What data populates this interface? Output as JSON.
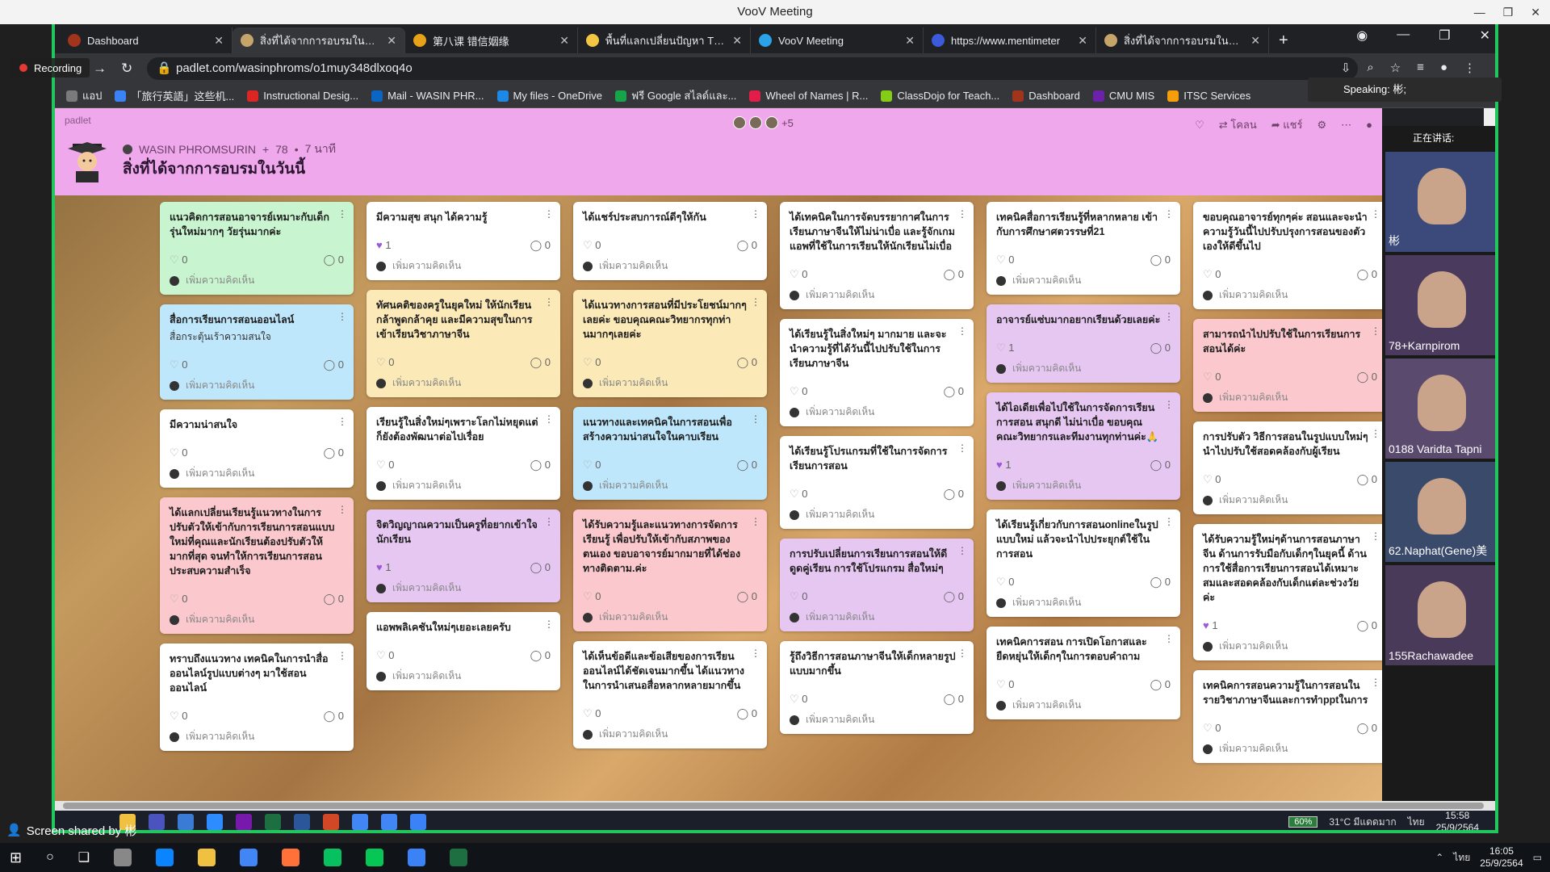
{
  "voov": {
    "title": "VooV Meeting",
    "recording_label": "Recording",
    "speaking_label": "Speaking: 彬;",
    "screen_shared_label": "Screen shared by 彬"
  },
  "browser": {
    "tabs": [
      {
        "label": "Dashboard",
        "active": false,
        "color": "#a0341c"
      },
      {
        "label": "สิ่งที่ได้จากการอบรมในวันนี้",
        "active": true,
        "color": "#c5a56a"
      },
      {
        "label": "第八课 错信姻缘",
        "active": false,
        "color": "#e8a21a"
      },
      {
        "label": "พื้นที่แลกเปลี่ยนปัญหา Thai",
        "active": false,
        "color": "#f4c542"
      },
      {
        "label": "VooV Meeting",
        "active": false,
        "color": "#2aa3e8"
      },
      {
        "label": "https://www.mentimeter",
        "active": false,
        "color": "#3b5bdb"
      },
      {
        "label": "สิ่งที่ได้จากการอบรมในวันนี้",
        "active": false,
        "color": "#c5a56a"
      }
    ],
    "url": "padlet.com/wasinphroms/o1muy348dlxoq4o",
    "bookmarks": [
      {
        "label": "แอป",
        "color": "#7a7a7a"
      },
      {
        "label": "「旅行英語」这些机...",
        "color": "#3b82f6"
      },
      {
        "label": "Instructional Desig...",
        "color": "#dc2626"
      },
      {
        "label": "Mail - WASIN PHR...",
        "color": "#0a66c2"
      },
      {
        "label": "My files - OneDrive",
        "color": "#1e88e5"
      },
      {
        "label": "ฟรี Google สไลด์และ...",
        "color": "#16a34a"
      },
      {
        "label": "Wheel of Names | R...",
        "color": "#e11d48"
      },
      {
        "label": "ClassDojo for Teach...",
        "color": "#84cc16"
      },
      {
        "label": "Dashboard",
        "color": "#a0341c"
      },
      {
        "label": "CMU MIS",
        "color": "#6b21a8"
      },
      {
        "label": "ITSC Services",
        "color": "#f59e0b"
      }
    ]
  },
  "padlet": {
    "brand": "padlet",
    "owner": "WASIN PHROMSURIN",
    "meta_count": "78",
    "meta_time": "7 นาที",
    "title": "สิ่งที่ได้จากการอบรมในวันนี้",
    "extra_members": "+5",
    "actions": {
      "remake": "โคลน",
      "share": "แชร์"
    },
    "comment_placeholder": "เพิ่มความคิดเห็น",
    "columns": [
      [
        {
          "title": "แนวคิดการสอนอาจารย์เหมาะกับเด็กรุ่นใหม่มากๆ วัยรุ่นมากค่ะ",
          "body": "",
          "likes": "0",
          "comments": "0",
          "color": "c-green",
          "liked": false
        },
        {
          "title": "สื่อการเรียนการสอนออนไลน์",
          "body": "สื่อกระตุ้นเร้าความสนใจ",
          "likes": "0",
          "comments": "0",
          "color": "c-blue",
          "liked": false
        },
        {
          "title": "มีความน่าสนใจ",
          "body": "",
          "likes": "0",
          "comments": "0",
          "color": "c-white",
          "liked": false
        },
        {
          "title": "ได้แลกเปลี่ยนเรียนรู้แนวทางในการปรับตัวให้เข้ากับการเรียนการสอนแบบใหม่ที่คุณและนักเรียนต้องปรับตัวให้มากที่สุด จนทำให้การเรียนการสอนประสบความสำเร็จ",
          "body": "",
          "likes": "0",
          "comments": "0",
          "color": "c-pink",
          "liked": false
        },
        {
          "title": "ทราบถึงแนวทาง เทคนิคในการนำสื่อออนไลน์รูปแบบต่างๆ มาใช้สอนออนไลน์",
          "body": "",
          "likes": "0",
          "comments": "0",
          "color": "c-white",
          "liked": false
        }
      ],
      [
        {
          "title": "มีความสุข สนุก ได้ความรู้",
          "body": "",
          "likes": "1",
          "comments": "0",
          "color": "c-white",
          "liked": true
        },
        {
          "title": "ทัศนคติของครูในยุคใหม่ ให้นักเรียนกล้าพูดกล้าคุย และมีความสุขในการเข้าเรียนวิชาภาษาจีน",
          "body": "",
          "likes": "0",
          "comments": "0",
          "color": "c-yellow",
          "liked": false
        },
        {
          "title": "เรียนรู้ในสิ่งใหม่ๆเพราะโลกไม่หยุดแต่ก็ยังต้องพัฒนาต่อไปเรื่อย",
          "body": "",
          "likes": "0",
          "comments": "0",
          "color": "c-white",
          "liked": false
        },
        {
          "title": "จิตวิญญาณความเป็นครูที่อยากเข้าใจนักเรียน",
          "body": "",
          "likes": "1",
          "comments": "0",
          "color": "c-purple",
          "liked": true
        },
        {
          "title": "แอพพลิเคชันใหม่ๆเยอะเลยครับ",
          "body": "",
          "likes": "0",
          "comments": "0",
          "color": "c-white",
          "liked": false
        }
      ],
      [
        {
          "title": "ได้แชร์ประสบการณ์ดีๆให้กัน",
          "body": "",
          "likes": "0",
          "comments": "0",
          "color": "c-white",
          "liked": false
        },
        {
          "title": "ได้แนวทางการสอนที่มีประโยชน์มากๆเลยค่ะ ขอบคุณคณะวิทยากรทุกท่านมากๆเลยค่ะ",
          "body": "",
          "likes": "0",
          "comments": "0",
          "color": "c-yellow",
          "liked": false
        },
        {
          "title": "แนวทางและเทคนิคในการสอนเพื่อสร้างความน่าสนใจในคาบเรียน",
          "body": "",
          "likes": "0",
          "comments": "0",
          "color": "c-blue",
          "liked": false
        },
        {
          "title": "ได้รับความรู้และแนวทางการจัดการเรียนรู้ เพื่อปรับให้เข้ากับสภาพของตนเอง ขอบอาจารย์มากมายที่ได้ช่องทางติดตาม.ค่ะ",
          "body": "",
          "likes": "0",
          "comments": "0",
          "color": "c-pink",
          "liked": false
        },
        {
          "title": "ได้เห็นข้อดีและข้อเสียของการเรียนออนไลน์ได้ชัดเจนมากขึ้น ได้แนวทางในการนำเสนอสื่อหลากหลายมากขึ้น",
          "body": "",
          "likes": "0",
          "comments": "0",
          "color": "c-white",
          "liked": false
        }
      ],
      [
        {
          "title": "ได้เทคนิคในการจัดบรรยากาศในการเรียนภาษาจีนให้ไม่น่าเบื่อ และรู้จักเกมแอพที่ใช้ในการเรียนให้นักเรียนไม่เบื่อ",
          "body": "",
          "likes": "0",
          "comments": "0",
          "color": "c-white",
          "liked": false
        },
        {
          "title": "ได้เรียนรู้ในสิ่งใหม่ๆ มากมาย และจะนำความรู้ที่ได้วันนี้ไปปรับใช้ในการเรียนภาษาจีน",
          "body": "",
          "likes": "0",
          "comments": "0",
          "color": "c-white",
          "liked": false
        },
        {
          "title": "ได้เรียนรู้โปรแกรมที่ใช้ในการจัดการเรียนการสอน",
          "body": "",
          "likes": "0",
          "comments": "0",
          "color": "c-white",
          "liked": false
        },
        {
          "title": "การปรับเปลี่ยนการเรียนการสอนให้ดีดูดคู่เรียน การใช้โปรแกรม สื่อใหม่ๆ",
          "body": "",
          "likes": "0",
          "comments": "0",
          "color": "c-purple",
          "liked": false
        },
        {
          "title": "รู้ถึงวิธีการสอนภาษาจีนให้เด็กหลายรูปแบบมากขึ้น",
          "body": "",
          "likes": "0",
          "comments": "0",
          "color": "c-white",
          "liked": false
        }
      ],
      [
        {
          "title": "เทคนิคสื่อการเรียนรู้ที่หลากหลาย เข้ากับการศึกษาศตวรรษที่21",
          "body": "",
          "likes": "0",
          "comments": "0",
          "color": "c-white",
          "liked": false
        },
        {
          "title": "อาจารย์แซ่บมากอยากเรียนด้วยเลยค่ะ",
          "body": "",
          "likes": "1",
          "comments": "0",
          "color": "c-purple",
          "liked": false
        },
        {
          "title": "ได้ไอเดียเพื่อไปใช้ในการจัดการเรียนการสอน สนุกดี ไม่น่าเบื่อ ขอบคุณคณะวิทยากรและทีมงานทุกท่านค่ะ🙏",
          "body": "",
          "likes": "1",
          "comments": "0",
          "color": "c-purple",
          "liked": true
        },
        {
          "title": "ได้เรียนรู้เกี่ยวกับการสอนonlineในรูปแบบใหม่ แล้วจะนำไปประยุกต์ใช้ในการสอน",
          "body": "",
          "likes": "0",
          "comments": "0",
          "color": "c-white",
          "liked": false
        },
        {
          "title": "เทคนิคการสอน การเปิดโอกาสและยืดหยุ่นให้เด็กๆในการตอบคำถาม",
          "body": "",
          "likes": "0",
          "comments": "0",
          "color": "c-white",
          "liked": false
        }
      ],
      [
        {
          "title": "ขอบคุณอาจารย์ทุกๆค่ะ สอนและจะนำความรู้วันนี้ไปปรับปรุงการสอนของตัวเองให้ดีขึ้นไป",
          "body": "",
          "likes": "0",
          "comments": "0",
          "color": "c-white",
          "liked": false
        },
        {
          "title": "สามารถนำไปปรับใช้ในการเรียนการสอนได้ค่ะ",
          "body": "",
          "likes": "0",
          "comments": "0",
          "color": "c-pink",
          "liked": false
        },
        {
          "title": "การปรับตัว วิธีการสอนในรูปแบบใหม่ๆนำไปปรับใช้สอดคล้องกับผู้เรียน",
          "body": "",
          "likes": "0",
          "comments": "0",
          "color": "c-white",
          "liked": false
        },
        {
          "title": "ได้รับความรู้ใหม่ๆด้านการสอนภาษาจีน ด้านการรับมือกับเด็กๆในยุคนี้ ด้านการใช้สื่อการเรียนการสอนได้เหมาะสมและสอดคล้องกับเด็กแต่ละช่วงวัยค่ะ",
          "body": "",
          "likes": "1",
          "comments": "0",
          "color": "c-white",
          "liked": true
        },
        {
          "title": "เทคนิคการสอนความรู้ในการสอนในรายวิชาภาษาจีนและการทำpptในการ",
          "body": "",
          "likes": "0",
          "comments": "0",
          "color": "c-white",
          "liked": false
        }
      ]
    ]
  },
  "participants": {
    "header": "正在讲话:",
    "tiles": [
      {
        "name": "彬",
        "color": "#3b4a7a"
      },
      {
        "name": "78+Karnpirom",
        "color": "#4a3a5e"
      },
      {
        "name": "0188 Varidta Tapni",
        "color": "#5a4a6e"
      },
      {
        "name": "62.Naphat(Gene)美",
        "color": "#3a4a6a"
      },
      {
        "name": "155Rachawadee",
        "color": "#4a3a5a"
      }
    ]
  },
  "remote_taskbar": {
    "battery": "60%",
    "weather": "31°C มีแดดมาก",
    "lang": "ไทย",
    "time": "15:58",
    "date": "25/9/2564",
    "icons": [
      "#f0c040",
      "#4b53bc",
      "#3a7bd5",
      "#2d8cff",
      "#7719aa",
      "#1d6f42",
      "#2b579a",
      "#d24726",
      "#4285f4",
      "#4285f4",
      "#3b82f6"
    ]
  },
  "taskbar": {
    "time": "16:05",
    "date": "25/9/2564",
    "lang": "ไทย",
    "icons": [
      "#888888",
      "#0a84ff",
      "#f0c040",
      "#4285f4",
      "#ff7139",
      "#07c160",
      "#06c755",
      "#3b82f6",
      "#1d6f42"
    ]
  }
}
